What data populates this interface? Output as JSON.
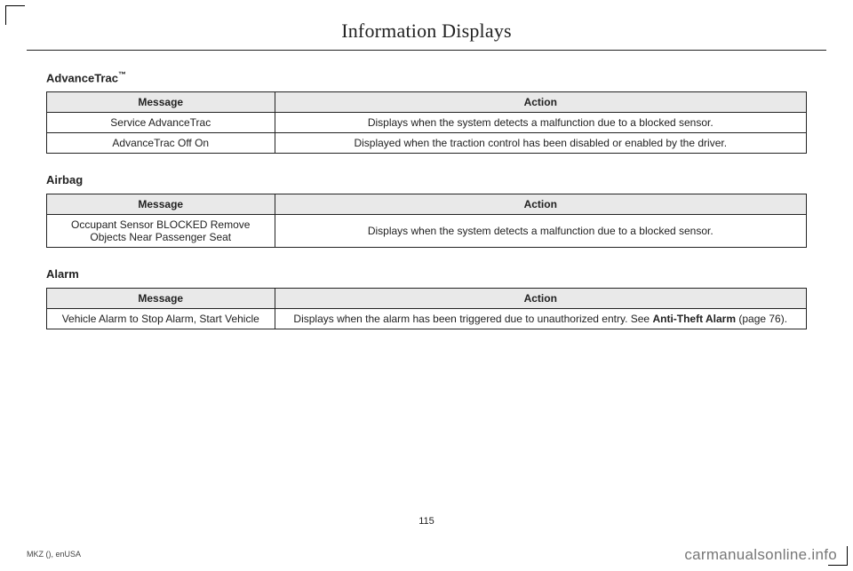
{
  "header": {
    "title": "Information Displays"
  },
  "sections": [
    {
      "heading": "AdvanceTrac",
      "heading_suffix": "™",
      "columns": {
        "message": "Message",
        "action": "Action"
      },
      "rows": [
        {
          "message": "Service AdvanceTrac",
          "action": "Displays when the system detects a malfunction due to a blocked sensor."
        },
        {
          "message": "AdvanceTrac Off On",
          "action": "Displayed when the traction control has been disabled or enabled by the driver."
        }
      ]
    },
    {
      "heading": "Airbag",
      "columns": {
        "message": "Message",
        "action": "Action"
      },
      "rows": [
        {
          "message": "Occupant Sensor BLOCKED Remove Objects Near Passenger Seat",
          "action": "Displays when the system detects a malfunction due to a blocked sensor."
        }
      ]
    },
    {
      "heading": "Alarm",
      "columns": {
        "message": "Message",
        "action": "Action"
      },
      "rows": [
        {
          "message": "Vehicle Alarm to Stop Alarm, Start Vehicle",
          "action_pre": "Displays when the alarm has been triggered due to unauthorized entry.  See ",
          "action_bold": "Anti-Theft Alarm",
          "action_post": " (page 76)."
        }
      ]
    }
  ],
  "footer": {
    "page_number": "115",
    "doc_code": "MKZ (), enUSA",
    "watermark": "carmanualsonline.info"
  }
}
